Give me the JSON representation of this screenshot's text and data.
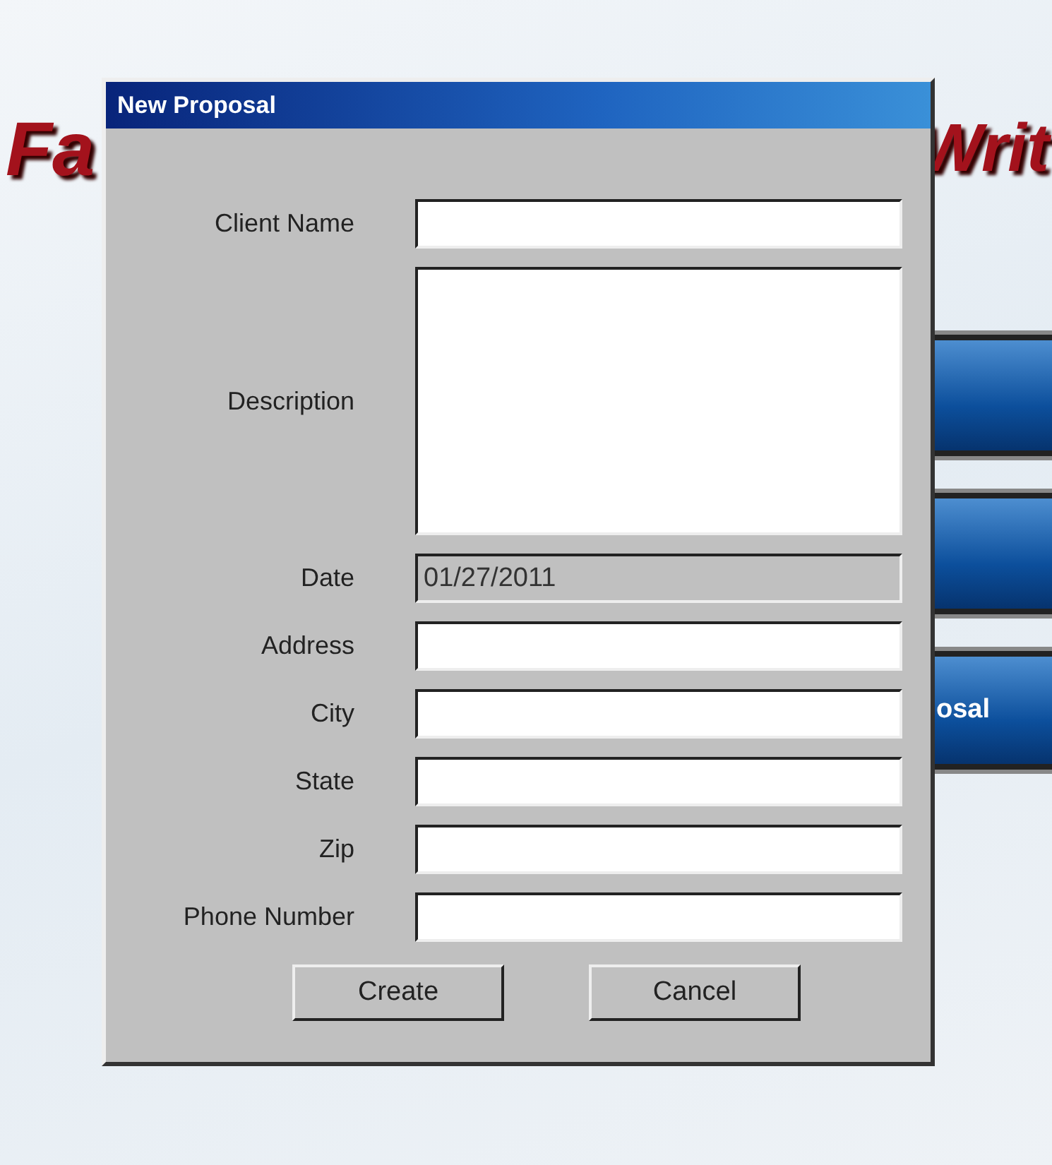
{
  "background": {
    "heading_left": "Fa",
    "heading_right": "Writ",
    "side_buttons": [
      {
        "kind": "blank"
      },
      {
        "kind": "blank"
      },
      {
        "kind": "label",
        "label": "osal"
      }
    ]
  },
  "dialog": {
    "title": "New Proposal",
    "fields": [
      {
        "label": "Client Name",
        "kind": "text",
        "disabled": false
      },
      {
        "label": "Description",
        "kind": "textarea",
        "disabled": false
      },
      {
        "label": "Date",
        "kind": "text",
        "disabled": true,
        "value": "01/27/2011"
      },
      {
        "label": "Address",
        "kind": "text",
        "disabled": false
      },
      {
        "label": "City",
        "kind": "text",
        "disabled": false
      },
      {
        "label": "State",
        "kind": "text",
        "disabled": false
      },
      {
        "label": "Zip",
        "kind": "text",
        "disabled": false
      },
      {
        "label": "Phone Number",
        "kind": "text",
        "disabled": false
      }
    ],
    "buttons": [
      "Create",
      "Cancel"
    ]
  }
}
